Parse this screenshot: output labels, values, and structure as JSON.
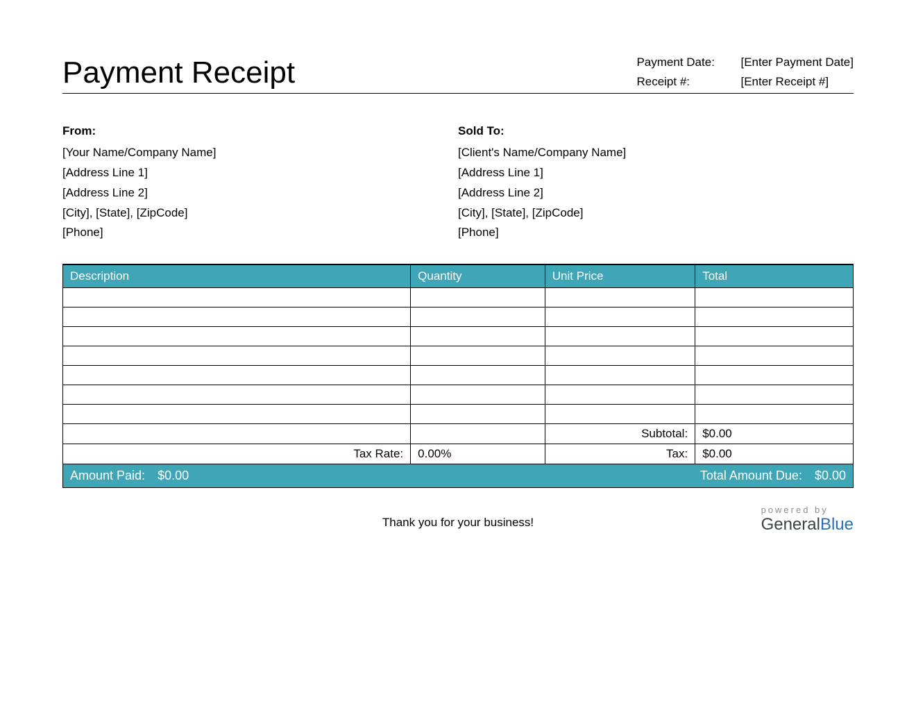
{
  "title": "Payment Receipt",
  "meta": {
    "payment_date_label": "Payment Date:",
    "payment_date_value": "[Enter Payment Date]",
    "receipt_num_label": "Receipt #:",
    "receipt_num_value": "[Enter Receipt #]"
  },
  "from": {
    "heading": "From:",
    "line1": "[Your Name/Company Name]",
    "line2": "[Address Line 1]",
    "line3": "[Address Line 2]",
    "line4": "[City], [State], [ZipCode]",
    "line5": "[Phone]"
  },
  "sold_to": {
    "heading": "Sold To:",
    "line1": "[Client's Name/Company Name]",
    "line2": "[Address Line 1]",
    "line3": "[Address Line 2]",
    "line4": "[City], [State], [ZipCode]",
    "line5": "[Phone]"
  },
  "columns": {
    "description": "Description",
    "quantity": "Quantity",
    "unit_price": "Unit Price",
    "total": "Total"
  },
  "summary": {
    "subtotal_label": "Subtotal:",
    "subtotal_value": "$0.00",
    "tax_rate_label": "Tax Rate:",
    "tax_rate_value": "0.00%",
    "tax_label": "Tax:",
    "tax_value": "$0.00"
  },
  "footer": {
    "amount_paid_label": "Amount Paid:",
    "amount_paid_value": "$0.00",
    "total_due_label": "Total Amount Due:",
    "total_due_value": "$0.00"
  },
  "thanks": "Thank you for your business!",
  "brand": {
    "powered": "powered by",
    "name1": "General",
    "name2": "Blue"
  }
}
